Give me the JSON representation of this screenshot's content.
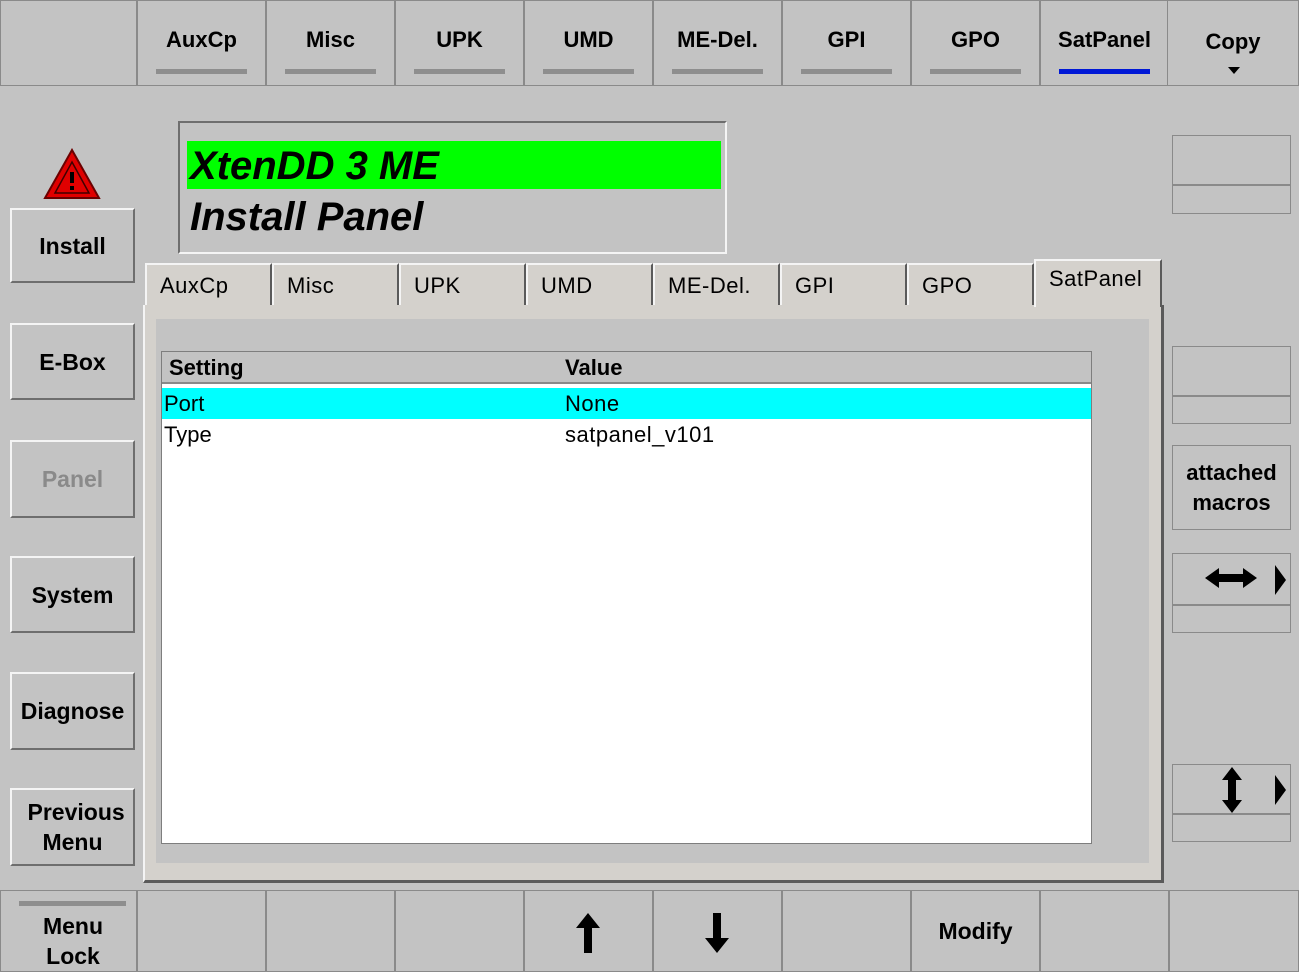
{
  "top_tabs": [
    {
      "label": "AuxCp",
      "active": false
    },
    {
      "label": "Misc",
      "active": false
    },
    {
      "label": "UPK",
      "active": false
    },
    {
      "label": "UMD",
      "active": false
    },
    {
      "label": "ME-Del.",
      "active": false
    },
    {
      "label": "GPI",
      "active": false
    },
    {
      "label": "GPO",
      "active": false
    },
    {
      "label": "SatPanel",
      "active": true
    }
  ],
  "copy_button": {
    "label": "Copy",
    "icon": "dropdown-arrow-icon"
  },
  "header": {
    "title": "XtenDD 3 ME",
    "subtitle": "Install Panel",
    "title_highlight_color": "#00ff00",
    "warning_icon": "warning-triangle-icon"
  },
  "left_menu": [
    {
      "label": "Install"
    },
    {
      "label": "E-Box"
    },
    {
      "label": "Panel",
      "disabled": true
    },
    {
      "label": "System"
    },
    {
      "label": "Diagnose"
    },
    {
      "label": "Previous Menu"
    }
  ],
  "inner_tabs": [
    {
      "label": "AuxCp"
    },
    {
      "label": "Misc"
    },
    {
      "label": "UPK"
    },
    {
      "label": "UMD"
    },
    {
      "label": "ME-Del."
    },
    {
      "label": "GPI"
    },
    {
      "label": "GPO"
    },
    {
      "label": "SatPanel",
      "active": true
    }
  ],
  "table": {
    "columns": [
      "Setting",
      "Value"
    ],
    "rows": [
      {
        "setting": "Port",
        "value": "None",
        "selected": true
      },
      {
        "setting": "Type",
        "value": "satpanel_v101",
        "selected": false
      }
    ],
    "selection_color": "#00ffff"
  },
  "right_panel": {
    "attached_macros": "attached macros",
    "horizontal_scroll_icon": "left-right-arrow-icon",
    "vertical_scroll_icon": "up-down-arrow-icon",
    "expand_icon": "triangle-right-icon"
  },
  "bottom_bar": {
    "menu_lock": "Menu Lock",
    "up_icon": "arrow-up-icon",
    "down_icon": "arrow-down-icon",
    "modify": "Modify"
  }
}
